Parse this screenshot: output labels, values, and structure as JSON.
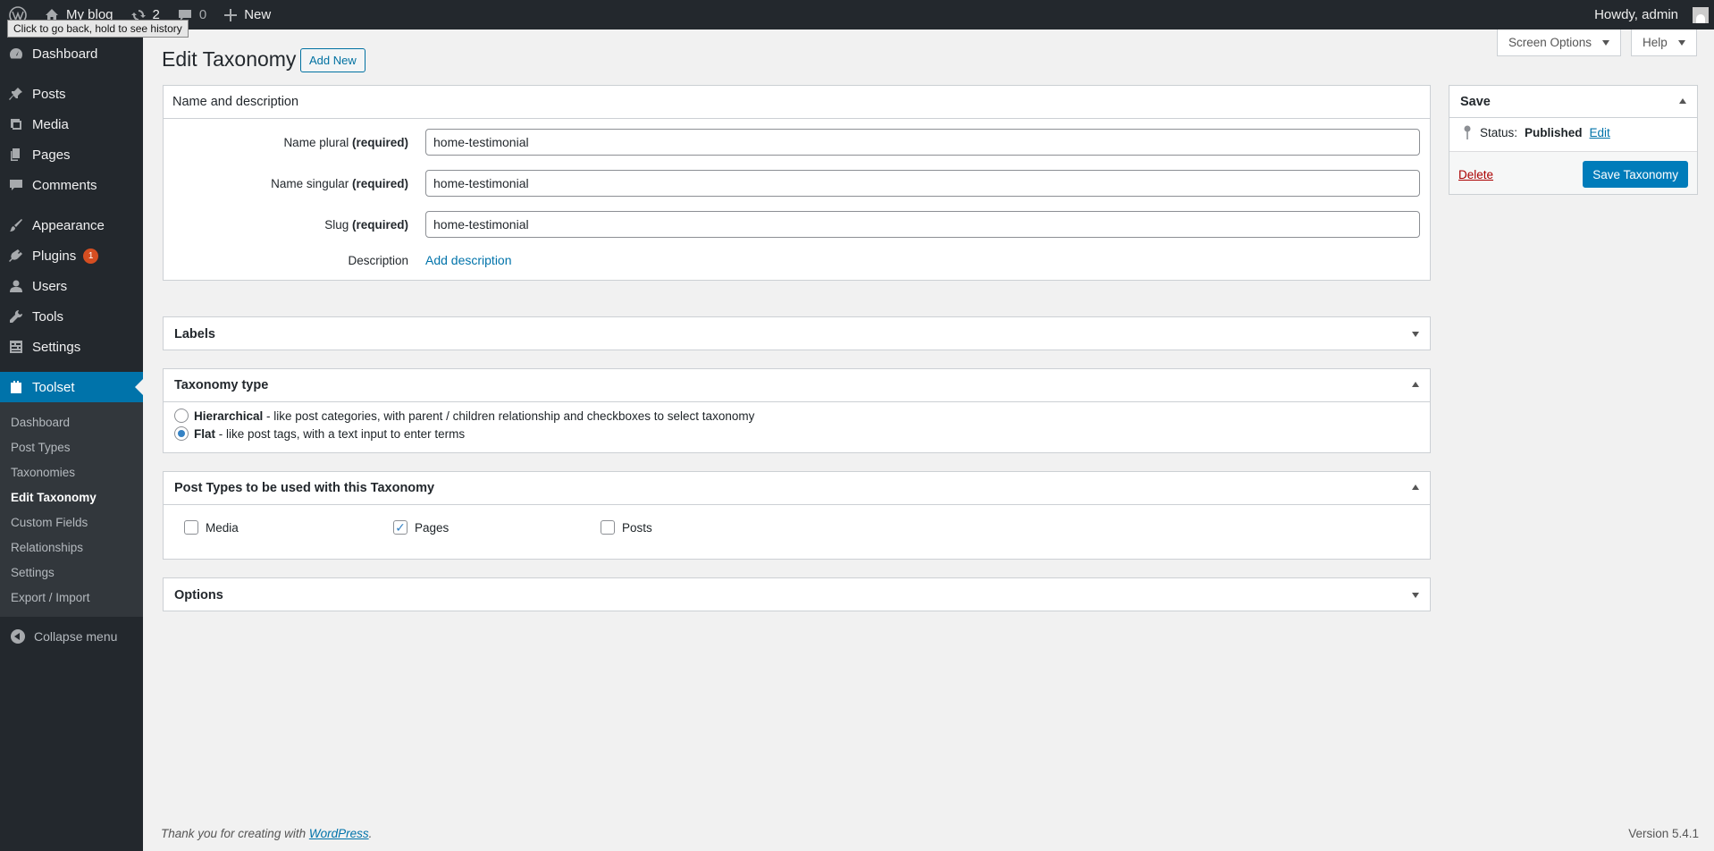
{
  "adminbar": {
    "site_name": "My blog",
    "updates_count": "2",
    "comments_count": "0",
    "new_label": "New",
    "howdy": "Howdy, admin",
    "tooltip": "Click to go back, hold to see history"
  },
  "sidebar": {
    "items": [
      {
        "label": "Dashboard",
        "icon": "dashboard-icon"
      },
      {
        "label": "Posts",
        "icon": "pin-icon"
      },
      {
        "label": "Media",
        "icon": "media-icon"
      },
      {
        "label": "Pages",
        "icon": "pages-icon"
      },
      {
        "label": "Comments",
        "icon": "comment-icon"
      },
      {
        "label": "Appearance",
        "icon": "brush-icon"
      },
      {
        "label": "Plugins",
        "icon": "plugin-icon",
        "badge": "1"
      },
      {
        "label": "Users",
        "icon": "user-icon"
      },
      {
        "label": "Tools",
        "icon": "wrench-icon"
      },
      {
        "label": "Settings",
        "icon": "settings-icon"
      },
      {
        "label": "Toolset",
        "icon": "toolset-icon"
      }
    ],
    "submenu": [
      "Dashboard",
      "Post Types",
      "Taxonomies",
      "Edit Taxonomy",
      "Custom Fields",
      "Relationships",
      "Settings",
      "Export / Import"
    ],
    "collapse_label": "Collapse menu"
  },
  "screen_options_label": "Screen Options",
  "help_label": "Help",
  "header": {
    "title": "Edit Taxonomy",
    "add_new_label": "Add New"
  },
  "name_box": {
    "title": "Name and description",
    "fields": [
      {
        "label": "Name plural",
        "required": "(required)",
        "value": "home-testimonial"
      },
      {
        "label": "Name singular",
        "required": "(required)",
        "value": "home-testimonial"
      },
      {
        "label": "Slug",
        "required": "(required)",
        "value": "home-testimonial"
      }
    ],
    "description_label": "Description",
    "add_description_link": "Add description"
  },
  "labels_box": {
    "title": "Labels"
  },
  "taxonomy_type": {
    "title": "Taxonomy type",
    "options": [
      {
        "name": "Hierarchical",
        "desc": " - like post categories, with parent / children relationship and checkboxes to select taxonomy",
        "selected": false
      },
      {
        "name": "Flat",
        "desc": " - like post tags, with a text input to enter terms",
        "selected": true
      }
    ]
  },
  "post_types": {
    "title": "Post Types to be used with this Taxonomy",
    "items": [
      {
        "label": "Media",
        "checked": false
      },
      {
        "label": "Pages",
        "checked": true
      },
      {
        "label": "Posts",
        "checked": false
      }
    ]
  },
  "options_box": {
    "title": "Options"
  },
  "save_box": {
    "title": "Save",
    "status_label": "Status:",
    "status_value": "Published",
    "edit_link": "Edit",
    "delete_label": "Delete",
    "save_button": "Save Taxonomy"
  },
  "footer": {
    "thanks_prefix": "Thank you for creating with ",
    "wordpress_link": "WordPress",
    "thanks_suffix": ".",
    "version": "Version 5.4.1"
  }
}
